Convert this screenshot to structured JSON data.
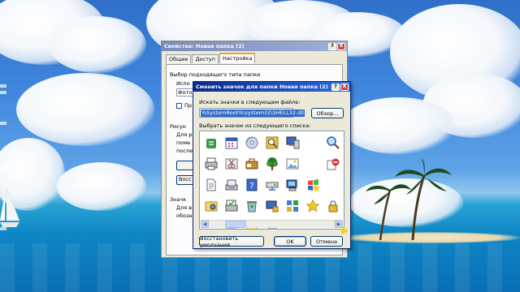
{
  "properties_dialog": {
    "title": "Свойства: Новая папка (2)",
    "help_button": "?",
    "close_button": "X",
    "tabs": [
      {
        "label": "Общие",
        "active": false
      },
      {
        "label": "Доступ",
        "active": false
      },
      {
        "label": "Настройка",
        "active": true
      }
    ],
    "folder_type_group": "Выбор подходящего типа папки",
    "use_template_label": "Испо",
    "template_select_value": "Фото",
    "apply_subfolders_checkbox": "Пр",
    "pictures_group": "Рисун",
    "pictures_text_1": "Для р",
    "pictures_text_2": "поме",
    "pictures_text_3": "после",
    "restore_button": "Восс",
    "folder_icons_group": "Значк",
    "folder_icons_text_1": "Для в",
    "folder_icons_text_2": "обозн"
  },
  "change_icon_dialog": {
    "title": "Сменить значок для папки Новая папка (2)",
    "help_button": "?",
    "close_button": "X",
    "search_label": "Искать значки в следующем файле:",
    "file_path": "%SystemRoot%\\system32\\SHELL32.dll",
    "browse_button": "Обзор...",
    "select_label": "Выбрать значок из следующего списка:",
    "restore_defaults_button": "Восстановить умолчания",
    "ok_button": "OK",
    "cancel_button": "Отмена",
    "icons": [
      "recycle-icon",
      "calendar-icon",
      "globe-cd-icon",
      "search-icon",
      "network-computer-icon",
      "blank",
      "magnifier-icon",
      "printer-icon",
      "scissors-icon",
      "briefcase-icon",
      "tree-icon",
      "image-icon",
      "blank",
      "no-entry-icon",
      "document-icon",
      "scanner-icon",
      "help-book-icon",
      "network-drive-icon",
      "computer-icon",
      "windows-flag-icon",
      "blank",
      "folder-settings-icon",
      "printer-check-icon",
      "recycle-full-icon",
      "lock-computer-icon",
      "tiles-icon",
      "star-icon",
      "padlock-icon",
      "blank",
      "notepad-icon",
      "sticky-note-icon",
      "recycle-bin-icon"
    ]
  },
  "colors": {
    "active_title_start": "#0a2b8a",
    "active_title_end": "#2e6be0",
    "dialog_face": "#ece9d8",
    "selection": "#316ac5"
  }
}
